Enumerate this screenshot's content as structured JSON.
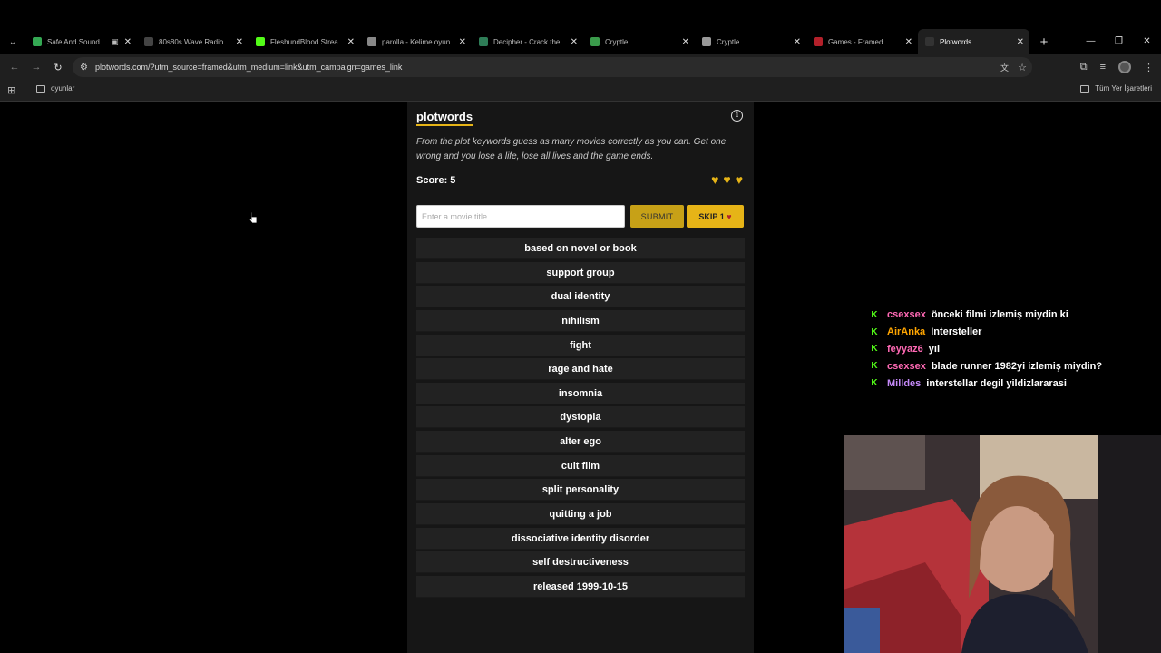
{
  "browser": {
    "tabs": [
      {
        "title": "Safe And Sound",
        "favicon_color": "#34a853",
        "audio": true
      },
      {
        "title": "80s80s Wave Radio",
        "favicon_color": "#444444"
      },
      {
        "title": "FleshundBlood Strea",
        "favicon_color": "#53fc18"
      },
      {
        "title": "parolla - Kelime oyun",
        "favicon_color": "#888888"
      },
      {
        "title": "Decipher - Crack the",
        "favicon_color": "#2e7d57"
      },
      {
        "title": "Cryptle",
        "favicon_color": "#3a9b4b"
      },
      {
        "title": "Cryptle",
        "favicon_color": "#999999"
      },
      {
        "title": "Games - Framed",
        "favicon_color": "#b3202a"
      },
      {
        "title": "Plotwords",
        "favicon_color": "#333333",
        "active": true
      }
    ],
    "url": "plotwords.com/?utm_source=framed&utm_medium=link&utm_campaign=games_link",
    "bookmarks": {
      "folder": "oyunlar",
      "all_bookmarks": "Tüm Yer İşaretleri"
    }
  },
  "game": {
    "title": "plotwords",
    "description": "From the plot keywords guess as many movies correctly as you can. Get one wrong and you lose a life, lose all lives and the game ends.",
    "score_label": "Score: 5",
    "lives": 3,
    "input_placeholder": "Enter a movie title",
    "submit_label": "SUBMIT",
    "skip_label": "SKIP 1",
    "keywords": [
      "based on novel or book",
      "support group",
      "dual identity",
      "nihilism",
      "fight",
      "rage and hate",
      "insomnia",
      "dystopia",
      "alter ego",
      "cult film",
      "split personality",
      "quitting a job",
      "dissociative identity disorder",
      "self destructiveness",
      "released 1999-10-15"
    ]
  },
  "chat": [
    {
      "user": "csexsex",
      "color": "#ff69b4",
      "message": "önceki filmi izlemiş miydin ki"
    },
    {
      "user": "AirAnka",
      "color": "#ffa500",
      "message": "Intersteller"
    },
    {
      "user": "feyyaz6",
      "color": "#ff69b4",
      "message": "yıl"
    },
    {
      "user": "csexsex",
      "color": "#ff69b4",
      "message": "blade runner 1982yi izlemiş miydin?"
    },
    {
      "user": "Milldes",
      "color": "#c58af9",
      "message": "interstellar degil yildizlararasi"
    }
  ]
}
